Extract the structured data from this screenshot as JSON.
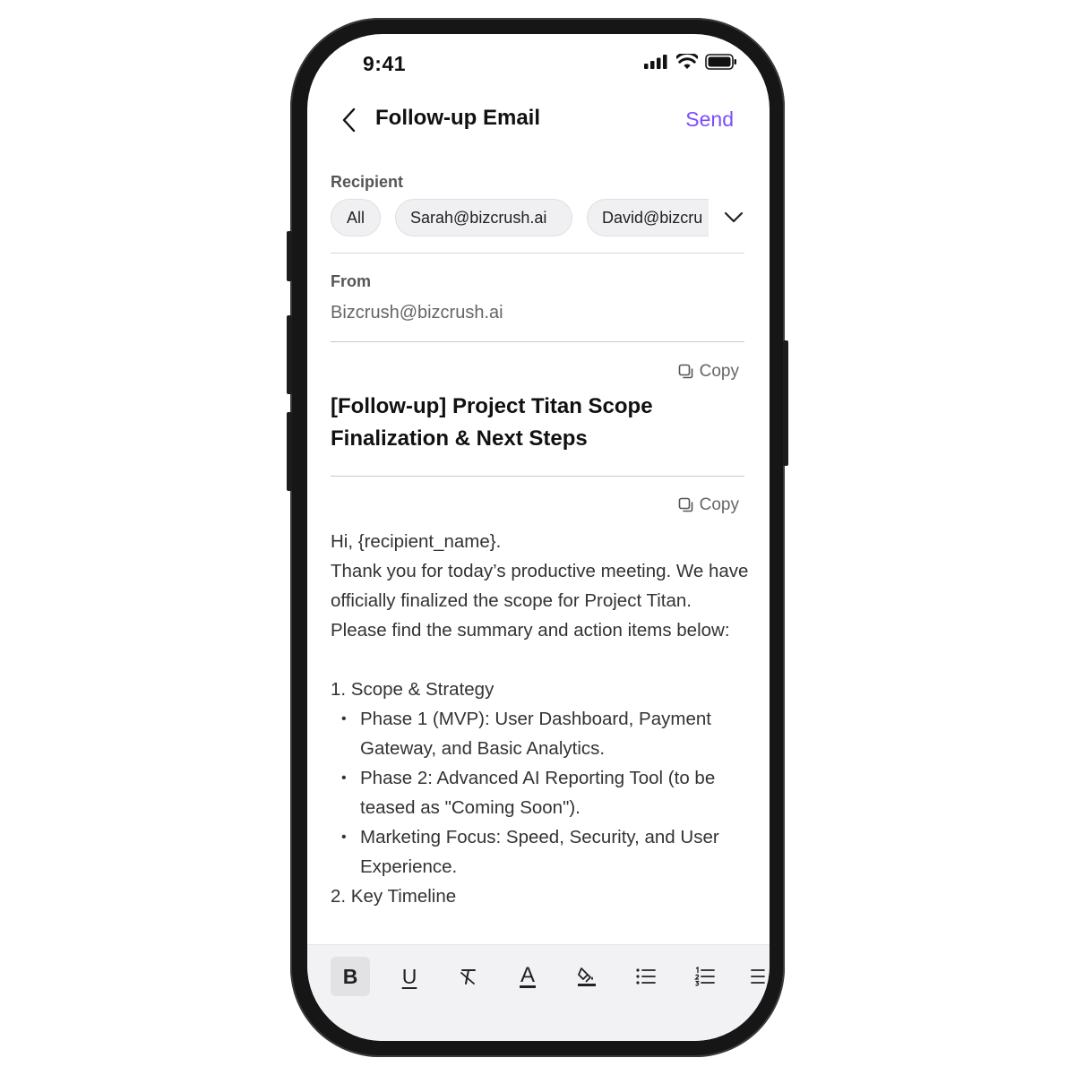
{
  "status": {
    "time": "9:41"
  },
  "header": {
    "title": "Follow-up Email",
    "send_label": "Send"
  },
  "recipient": {
    "label": "Recipient",
    "chips": [
      "All",
      "Sarah@bizcrush.ai",
      "David@bizcru"
    ]
  },
  "from": {
    "label": "From",
    "value": "Bizcrush@bizcrush.ai"
  },
  "subject": {
    "copy_label": "Copy",
    "text": "[Follow-up] Project Titan Scope Finalization & Next Steps"
  },
  "body": {
    "copy_label": "Copy",
    "greeting": "Hi, {recipient_name}.",
    "intro": "Thank you for today’s productive meeting. We have officially finalized the scope for Project Titan. Please find the summary and action items below:",
    "section1": "1. Scope & Strategy",
    "bullets": [
      "Phase 1 (MVP): User Dashboard, Payment Gateway, and Basic Analytics.",
      "Phase 2: Advanced AI Reporting Tool (to be teased as \"Coming Soon\").",
      "Marketing Focus: Speed, Security, and User Experience."
    ],
    "section2": "2. Key Timeline"
  },
  "toolbar": {
    "tools": [
      "bold-icon",
      "underline-icon",
      "clear-format-icon",
      "text-color-icon",
      "highlight-icon",
      "bullet-list-icon",
      "numbered-list-icon",
      "align-icon"
    ],
    "bold_glyph": "B",
    "underline_glyph": "U",
    "text_color_glyph": "A",
    "active": "bold-icon"
  },
  "colors": {
    "accent": "#7a4dff",
    "chip_bg": "#f0f0f2",
    "toolbar_bg": "#f2f2f4"
  }
}
